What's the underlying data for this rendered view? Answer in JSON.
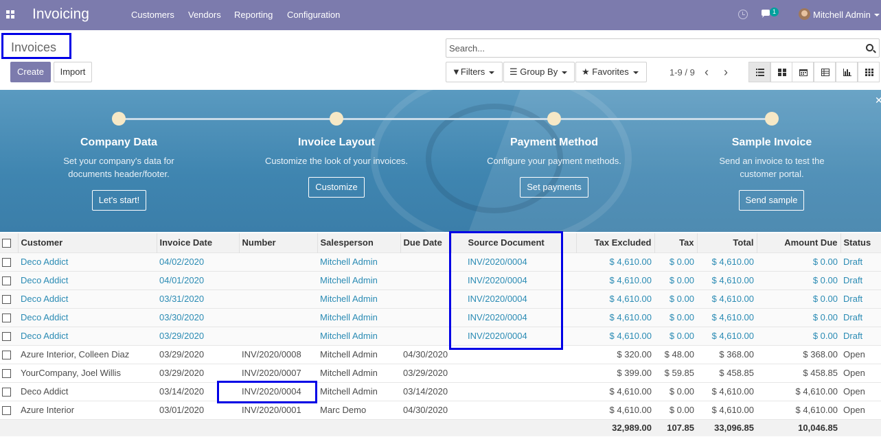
{
  "app": {
    "title": "Invoicing"
  },
  "menu": [
    "Customers",
    "Vendors",
    "Reporting",
    "Configuration"
  ],
  "systray": {
    "messages_badge": "1",
    "user_name": "Mitchell Admin"
  },
  "breadcrumb": "Invoices",
  "buttons": {
    "create": "Create",
    "import": "Import"
  },
  "search": {
    "placeholder": "Search..."
  },
  "filters": {
    "filters": "Filters",
    "group_by": "Group By",
    "favorites": "Favorites"
  },
  "pager": {
    "value": "1-9 / 9"
  },
  "views": [
    "list-view-icon",
    "kanban-view-icon",
    "calendar-view-icon",
    "pivot-view-icon",
    "graph-view-icon",
    "grid-view-icon"
  ],
  "onboarding": {
    "steps": [
      {
        "title": "Company Data",
        "desc_1": "Set your company's data for",
        "desc_2": "documents header/footer.",
        "button": "Let's start!"
      },
      {
        "title": "Invoice Layout",
        "desc_1": "Customize the look of your invoices.",
        "desc_2": "",
        "button": "Customize"
      },
      {
        "title": "Payment Method",
        "desc_1": "Configure your payment methods.",
        "desc_2": "",
        "button": "Set payments"
      },
      {
        "title": "Sample Invoice",
        "desc_1": "Send an invoice to test the",
        "desc_2": "customer portal.",
        "button": "Send sample"
      }
    ]
  },
  "table": {
    "columns": [
      "Customer",
      "Invoice Date",
      "Number",
      "Salesperson",
      "Due Date",
      "Source Document",
      "Tax Excluded",
      "Tax",
      "Total",
      "Amount Due",
      "Status"
    ],
    "rows": [
      {
        "customer": "Deco Addict",
        "date": "04/02/2020",
        "number": "",
        "salesperson": "Mitchell Admin",
        "due": "",
        "source": "INV/2020/0004",
        "tax_excl": "$ 4,610.00",
        "tax": "$ 0.00",
        "total": "$ 4,610.00",
        "due_amt": "$ 0.00",
        "status": "Draft"
      },
      {
        "customer": "Deco Addict",
        "date": "04/01/2020",
        "number": "",
        "salesperson": "Mitchell Admin",
        "due": "",
        "source": "INV/2020/0004",
        "tax_excl": "$ 4,610.00",
        "tax": "$ 0.00",
        "total": "$ 4,610.00",
        "due_amt": "$ 0.00",
        "status": "Draft"
      },
      {
        "customer": "Deco Addict",
        "date": "03/31/2020",
        "number": "",
        "salesperson": "Mitchell Admin",
        "due": "",
        "source": "INV/2020/0004",
        "tax_excl": "$ 4,610.00",
        "tax": "$ 0.00",
        "total": "$ 4,610.00",
        "due_amt": "$ 0.00",
        "status": "Draft"
      },
      {
        "customer": "Deco Addict",
        "date": "03/30/2020",
        "number": "",
        "salesperson": "Mitchell Admin",
        "due": "",
        "source": "INV/2020/0004",
        "tax_excl": "$ 4,610.00",
        "tax": "$ 0.00",
        "total": "$ 4,610.00",
        "due_amt": "$ 0.00",
        "status": "Draft"
      },
      {
        "customer": "Deco Addict",
        "date": "03/29/2020",
        "number": "",
        "salesperson": "Mitchell Admin",
        "due": "",
        "source": "INV/2020/0004",
        "tax_excl": "$ 4,610.00",
        "tax": "$ 0.00",
        "total": "$ 4,610.00",
        "due_amt": "$ 0.00",
        "status": "Draft"
      },
      {
        "customer": "Azure Interior, Colleen Diaz",
        "date": "03/29/2020",
        "number": "INV/2020/0008",
        "salesperson": "Mitchell Admin",
        "due": "04/30/2020",
        "source": "",
        "tax_excl": "$ 320.00",
        "tax": "$ 48.00",
        "total": "$ 368.00",
        "due_amt": "$ 368.00",
        "status": "Open"
      },
      {
        "customer": "YourCompany, Joel Willis",
        "date": "03/29/2020",
        "number": "INV/2020/0007",
        "salesperson": "Mitchell Admin",
        "due": "03/29/2020",
        "source": "",
        "tax_excl": "$ 399.00",
        "tax": "$ 59.85",
        "total": "$ 458.85",
        "due_amt": "$ 458.85",
        "status": "Open"
      },
      {
        "customer": "Deco Addict",
        "date": "03/14/2020",
        "number": "INV/2020/0004",
        "salesperson": "Mitchell Admin",
        "due": "03/14/2020",
        "source": "",
        "tax_excl": "$ 4,610.00",
        "tax": "$ 0.00",
        "total": "$ 4,610.00",
        "due_amt": "$ 4,610.00",
        "status": "Open"
      },
      {
        "customer": "Azure Interior",
        "date": "03/01/2020",
        "number": "INV/2020/0001",
        "salesperson": "Marc Demo",
        "due": "04/30/2020",
        "source": "",
        "tax_excl": "$ 4,610.00",
        "tax": "$ 0.00",
        "total": "$ 4,610.00",
        "due_amt": "$ 4,610.00",
        "status": "Open"
      }
    ],
    "totals": {
      "tax_excl": "32,989.00",
      "tax": "107.85",
      "total": "33,096.85",
      "due_amt": "10,046.85"
    }
  },
  "colors": {
    "brand": "#7c7bad",
    "link": "#2a8bb4",
    "highlight": "#0000e6"
  }
}
